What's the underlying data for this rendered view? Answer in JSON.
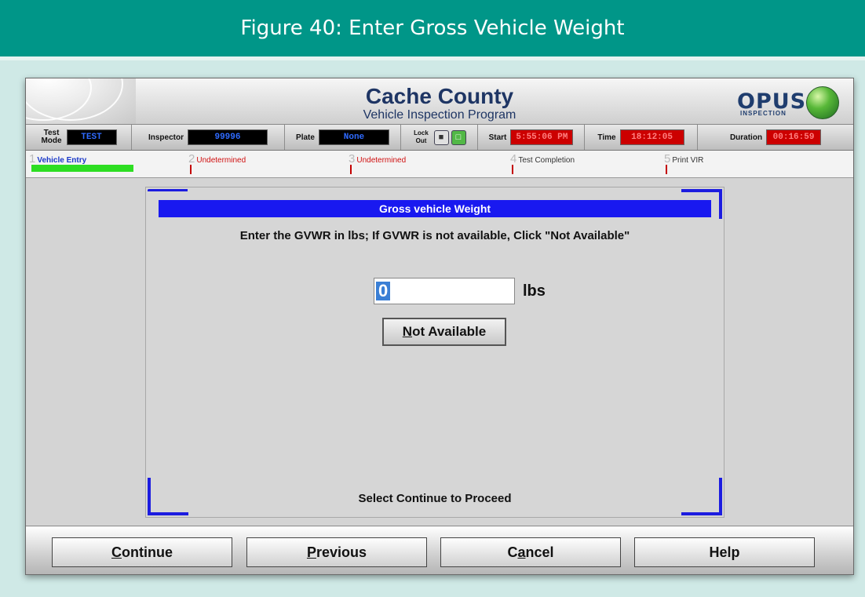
{
  "figure_caption": "Figure 40: Enter Gross Vehicle Weight",
  "app": {
    "title": "Cache County",
    "subtitle": "Vehicle Inspection Program",
    "logo_text": "OPUS",
    "logo_subtext": "INSPECTION"
  },
  "status_bar": {
    "test_mode_label": "Test Mode",
    "test_mode_value": "TEST",
    "inspector_label": "Inspector",
    "inspector_value": "99996",
    "plate_label": "Plate",
    "plate_value": "None",
    "lock_label": "Lock Out",
    "start_label": "Start",
    "start_value": "5:55:06 PM",
    "time_label": "Time",
    "time_value": "18:12:05",
    "duration_label": "Duration",
    "duration_value": "00:16:59"
  },
  "steps": [
    {
      "num": "1",
      "label": "Vehicle Entry"
    },
    {
      "num": "2",
      "label": "Undetermined"
    },
    {
      "num": "3",
      "label": "Undetermined"
    },
    {
      "num": "4",
      "label": "Test Completion"
    },
    {
      "num": "5",
      "label": "Print VIR"
    }
  ],
  "panel": {
    "heading": "Gross vehicle Weight",
    "instruction": "Enter the GVWR in lbs; If GVWR is not available, Click \"Not Available\"",
    "gvwr_value": "0",
    "unit": "lbs",
    "not_available_first": "N",
    "not_available_rest": "ot Available",
    "proceed_text": "Select Continue to Proceed"
  },
  "footer": {
    "continue_first": "C",
    "continue_rest": "ontinue",
    "previous_first": "P",
    "previous_rest": "revious",
    "cancel_pre": "C",
    "cancel_u": "a",
    "cancel_post": "ncel",
    "help": "Help"
  },
  "colors": {
    "banner": "#009688",
    "panel_header": "#1919f0",
    "progress_fill": "#2dde22"
  }
}
